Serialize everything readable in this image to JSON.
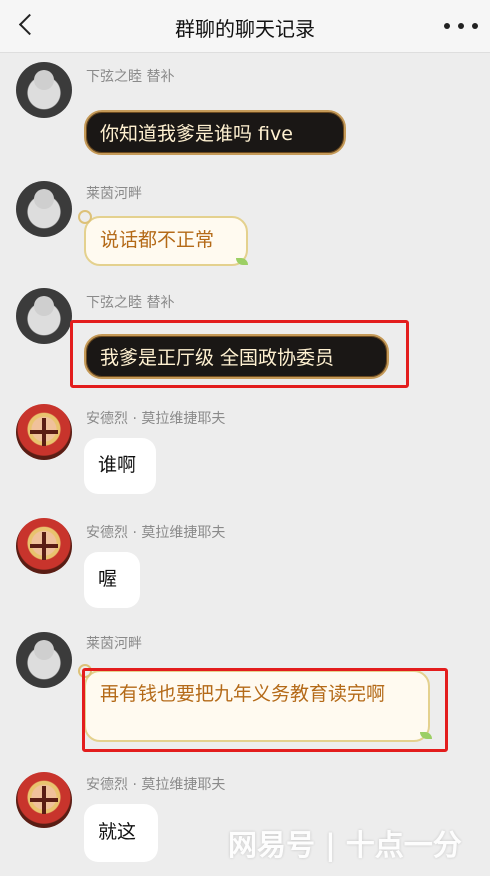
{
  "header": {
    "back_icon": "chevron-left-icon",
    "title": "群聊的聊天记录",
    "more_icon": "more-horizontal-icon"
  },
  "messages": [
    {
      "name": "下弦之睦 替补",
      "avatar": "union-jack-badge-avatar",
      "text": "你知道我爹是谁吗 five",
      "style": "dark-ornate",
      "highlighted": false
    },
    {
      "name": "莱茵河畔",
      "avatar": "soldier-photo-avatar",
      "text": "说话都不正常",
      "style": "cream-floral",
      "highlighted": false
    },
    {
      "name": "下弦之睦 替补",
      "avatar": "union-jack-badge-avatar",
      "text": "我爹是正厅级 全国政协委员",
      "style": "dark-ornate",
      "highlighted": true
    },
    {
      "name": "安德烈 · 莫拉维捷耶夫",
      "avatar": "red-army-cartoon-avatar",
      "text": "谁啊",
      "style": "plain",
      "highlighted": false
    },
    {
      "name": "安德烈 · 莫拉维捷耶夫",
      "avatar": "red-army-cartoon-avatar",
      "text": "喔",
      "style": "plain",
      "highlighted": false
    },
    {
      "name": "莱茵河畔",
      "avatar": "soldier-photo-avatar",
      "text": "再有钱也要把九年义务教育读完啊",
      "style": "cream-floral",
      "highlighted": true
    },
    {
      "name": "安德烈 · 莫拉维捷耶夫",
      "avatar": "red-army-cartoon-avatar",
      "text": "就这",
      "style": "plain",
      "highlighted": false
    }
  ],
  "watermark": "网易号 | 十点一分",
  "colors": {
    "background": "#ededed",
    "highlight": "#e31d1d",
    "dark_bubble": "#1a1715",
    "cream_text": "#b46a18"
  }
}
